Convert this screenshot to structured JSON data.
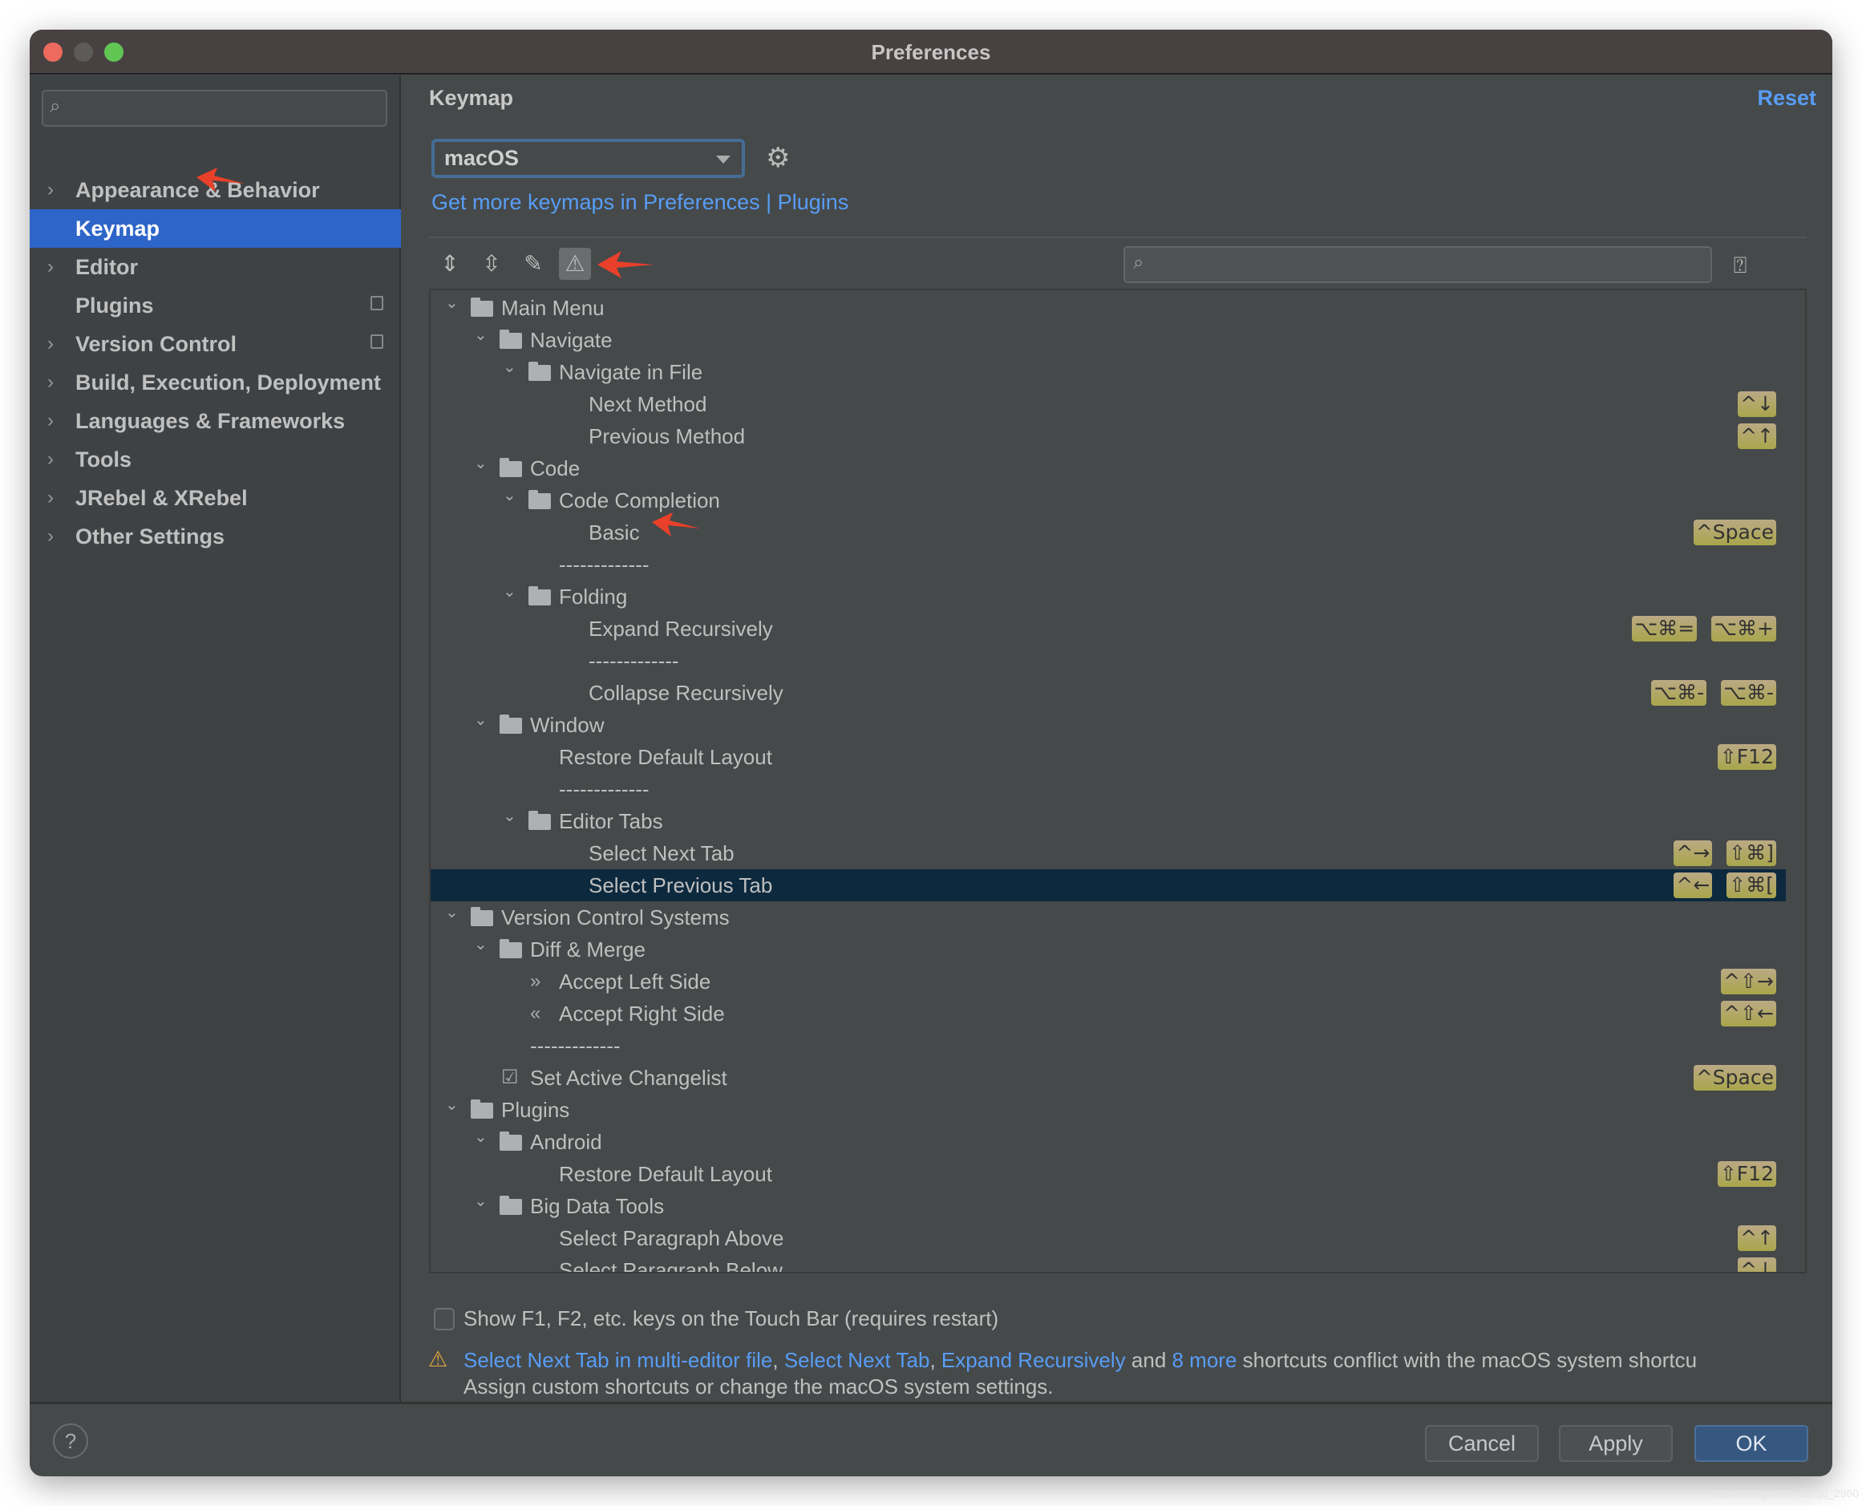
{
  "window": {
    "title": "Preferences"
  },
  "sidebar": {
    "items": [
      {
        "label": "Appearance & Behavior",
        "chevron": true
      },
      {
        "label": "Keymap",
        "selected": true
      },
      {
        "label": "Editor",
        "chevron": true
      },
      {
        "label": "Plugins",
        "badge": true
      },
      {
        "label": "Version Control",
        "chevron": true,
        "badge": true
      },
      {
        "label": "Build, Execution, Deployment",
        "chevron": true
      },
      {
        "label": "Languages & Frameworks",
        "chevron": true
      },
      {
        "label": "Tools",
        "chevron": true
      },
      {
        "label": "JRebel & XRebel",
        "chevron": true
      },
      {
        "label": "Other Settings",
        "chevron": true
      }
    ]
  },
  "main": {
    "title": "Keymap",
    "reset": "Reset",
    "keymap": "macOS",
    "link": "Get more keymaps in Preferences | Plugins",
    "tree": [
      {
        "label": "Main Menu",
        "level": 0,
        "type": "folder",
        "icon": "main-menu"
      },
      {
        "label": "Navigate",
        "level": 1,
        "type": "folder"
      },
      {
        "label": "Navigate in File",
        "level": 2,
        "type": "folder"
      },
      {
        "label": "Next Method",
        "level": 3,
        "type": "leaf",
        "shortcuts": [
          "^↓"
        ]
      },
      {
        "label": "Previous Method",
        "level": 3,
        "type": "leaf",
        "shortcuts": [
          "^↑"
        ]
      },
      {
        "label": "Code",
        "level": 1,
        "type": "folder"
      },
      {
        "label": "Code Completion",
        "level": 2,
        "type": "folder"
      },
      {
        "label": "Basic",
        "level": 3,
        "type": "leaf",
        "shortcuts": [
          "^Space"
        ]
      },
      {
        "label": "-------------",
        "level": 2,
        "type": "separator"
      },
      {
        "label": "Folding",
        "level": 2,
        "type": "folder"
      },
      {
        "label": "Expand Recursively",
        "level": 3,
        "type": "leaf",
        "shortcuts": [
          "⌥⌘+",
          "⌥⌘="
        ]
      },
      {
        "label": "-------------",
        "level": 3,
        "type": "separator"
      },
      {
        "label": "Collapse Recursively",
        "level": 3,
        "type": "leaf",
        "shortcuts": [
          "⌥⌘-",
          "⌥⌘-"
        ]
      },
      {
        "label": "Window",
        "level": 1,
        "type": "folder"
      },
      {
        "label": "Restore Default Layout",
        "level": 2,
        "type": "leaf",
        "shortcuts": [
          "⇧F12"
        ]
      },
      {
        "label": "-------------",
        "level": 2,
        "type": "separator"
      },
      {
        "label": "Editor Tabs",
        "level": 2,
        "type": "folder"
      },
      {
        "label": "Select Next Tab",
        "level": 3,
        "type": "leaf",
        "shortcuts": [
          "⇧⌘]",
          "^→"
        ]
      },
      {
        "label": "Select Previous Tab",
        "level": 3,
        "type": "leaf",
        "selected": true,
        "shortcuts": [
          "⇧⌘[",
          "^←"
        ]
      },
      {
        "label": "Version Control Systems",
        "level": 0,
        "type": "folder"
      },
      {
        "label": "Diff & Merge",
        "level": 1,
        "type": "folder"
      },
      {
        "label": "Accept Left Side",
        "level": 2,
        "type": "leaf",
        "icon": "»",
        "shortcuts": [
          "^⇧→"
        ]
      },
      {
        "label": "Accept Right Side",
        "level": 2,
        "type": "leaf",
        "icon": "«",
        "shortcuts": [
          "^⇧←"
        ]
      },
      {
        "label": "-------------",
        "level": 1,
        "type": "separator"
      },
      {
        "label": "Set Active Changelist",
        "level": 1,
        "type": "leaf",
        "icon": "☑",
        "shortcuts": [
          "^Space"
        ]
      },
      {
        "label": "Plugins",
        "level": 0,
        "type": "folder"
      },
      {
        "label": "Android",
        "level": 1,
        "type": "folder"
      },
      {
        "label": "Restore Default Layout",
        "level": 2,
        "type": "leaf",
        "shortcuts": [
          "⇧F12"
        ]
      },
      {
        "label": "Big Data Tools",
        "level": 1,
        "type": "folder"
      },
      {
        "label": "Select Paragraph Above",
        "level": 2,
        "type": "leaf",
        "shortcuts": [
          "^↑"
        ]
      },
      {
        "label": "Select Paragraph Below",
        "level": 2,
        "type": "leaf",
        "shortcuts": [
          "^↓"
        ]
      }
    ],
    "touchbar_label": "Show F1, F2, etc. keys on the Touch Bar (requires restart)",
    "touchbar_checked": false,
    "warning": {
      "link1": "Select Next Tab in multi-editor file",
      "comma1": ", ",
      "link2": "Select Next Tab",
      "comma2": ", ",
      "link3": "Expand Recursively",
      "and": " and ",
      "link4": "8 more",
      "rest": " shortcuts conflict with the macOS system shortcu",
      "line2": "Assign custom shortcuts or change the macOS system settings."
    }
  },
  "footer": {
    "help": "?",
    "cancel": "Cancel",
    "apply": "Apply",
    "ok": "OK"
  },
  "watermark": "https://blog.csdn.net/qq_2960",
  "colors": {
    "accent": "#589df6",
    "selection": "#2e65c8",
    "badge": "#a9a64b",
    "annotation": "#e8402a"
  }
}
